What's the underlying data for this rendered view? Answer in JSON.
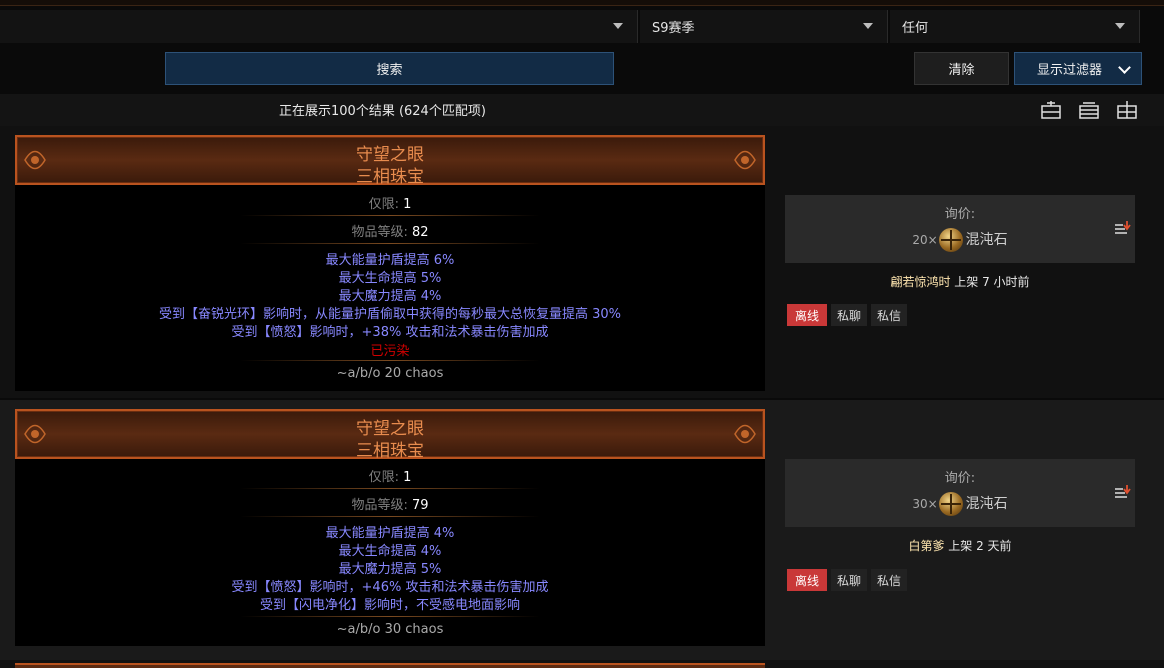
{
  "filters": {
    "league": "S9赛季",
    "status": "任何"
  },
  "actions": {
    "search": "搜索",
    "clear": "清除",
    "show_filters": "显示过滤器"
  },
  "results": {
    "summary": "正在展示100个结果 (624个匹配项)"
  },
  "view_modes": [
    "compact-view-icon",
    "list-view-icon",
    "expanded-view-icon"
  ],
  "listings": [
    {
      "name": "守望之眼",
      "base": "三相珠宝",
      "limit_label": "仅限:",
      "limit_value": "1",
      "ilvl_label": "物品等级:",
      "ilvl_value": "82",
      "mods": [
        "最大能量护盾提高 6%",
        "最大生命提高 5%",
        "最大魔力提高 4%",
        "受到【奋锐光环】影响时，从能量护盾偷取中获得的每秒最大总恢复量提高 30%",
        "受到【愤怒】影响时，+38% 攻击和法术暴击伤害加成"
      ],
      "corrupted": "已污染",
      "note": "~a/b/o 20 chaos",
      "price_label": "询价:",
      "price_amount": "20×",
      "currency": "混沌石",
      "account": "翩若惊鸿时",
      "listed": "上架 7 小时前",
      "btn_offline": "离线",
      "btn_whisper": "私聊",
      "btn_pm": "私信"
    },
    {
      "name": "守望之眼",
      "base": "三相珠宝",
      "limit_label": "仅限:",
      "limit_value": "1",
      "ilvl_label": "物品等级:",
      "ilvl_value": "79",
      "mods": [
        "最大能量护盾提高 4%",
        "最大生命提高 4%",
        "最大魔力提高 5%",
        "受到【愤怒】影响时，+46% 攻击和法术暴击伤害加成",
        "受到【闪电净化】影响时，不受感电地面影响"
      ],
      "note": "~a/b/o 30 chaos",
      "price_label": "询价:",
      "price_amount": "30×",
      "currency": "混沌石",
      "account": "白第爹",
      "listed": "上架 2 天前",
      "btn_offline": "离线",
      "btn_whisper": "私聊",
      "btn_pm": "私信"
    }
  ],
  "colors": {
    "unique": "#e88c4e",
    "magic_mod": "#8888ff",
    "corrupted": "#d20000",
    "accent": "#122b45"
  }
}
